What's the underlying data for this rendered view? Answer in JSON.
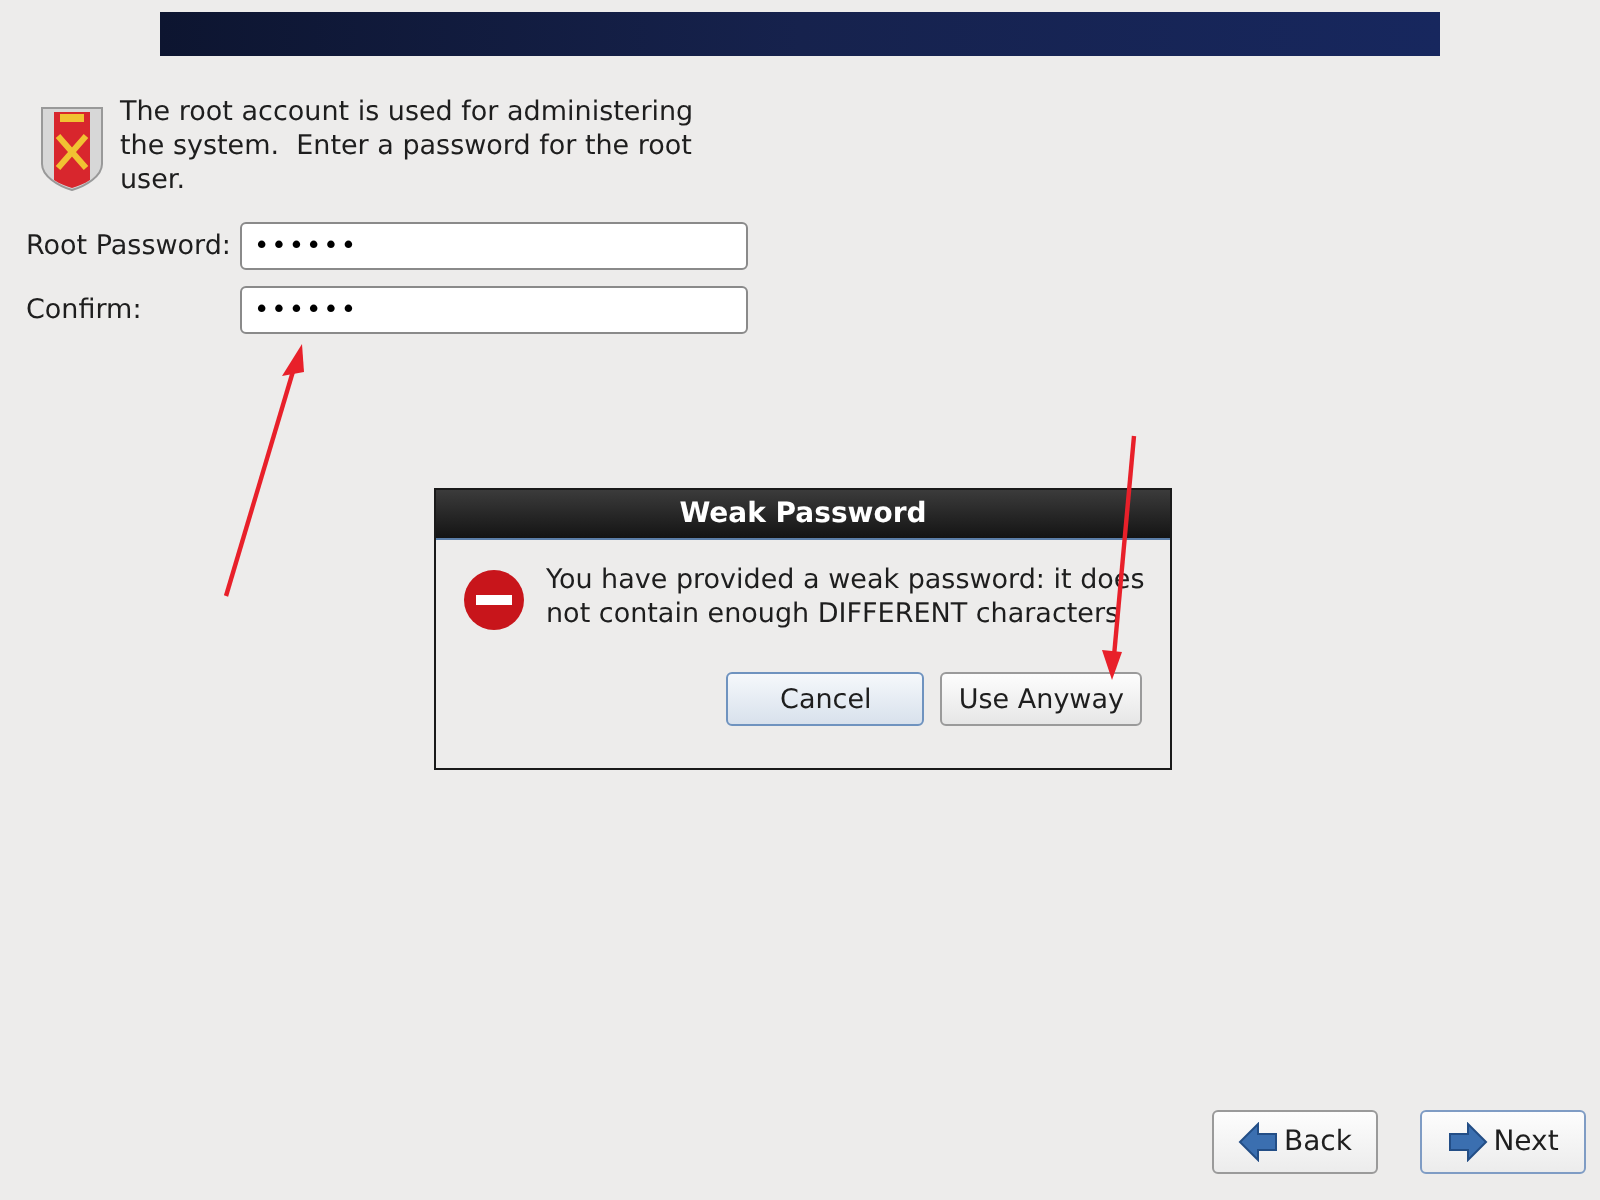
{
  "intro": "The root account is used for administering the system.  Enter a password for the root user.",
  "fields": [
    {
      "label": "Root Password:",
      "value": "••••••"
    },
    {
      "label": "Confirm:",
      "value": "••••••"
    }
  ],
  "dialog": {
    "title": "Weak Password",
    "message": "You have provided a weak password: it does not contain enough DIFFERENT characters",
    "buttons": [
      {
        "label": "Cancel",
        "focused": true
      },
      {
        "label": "Use Anyway",
        "focused": false
      }
    ]
  },
  "nav": [
    {
      "label": "Back",
      "kind": "back"
    },
    {
      "label": "Next",
      "kind": "next"
    }
  ]
}
